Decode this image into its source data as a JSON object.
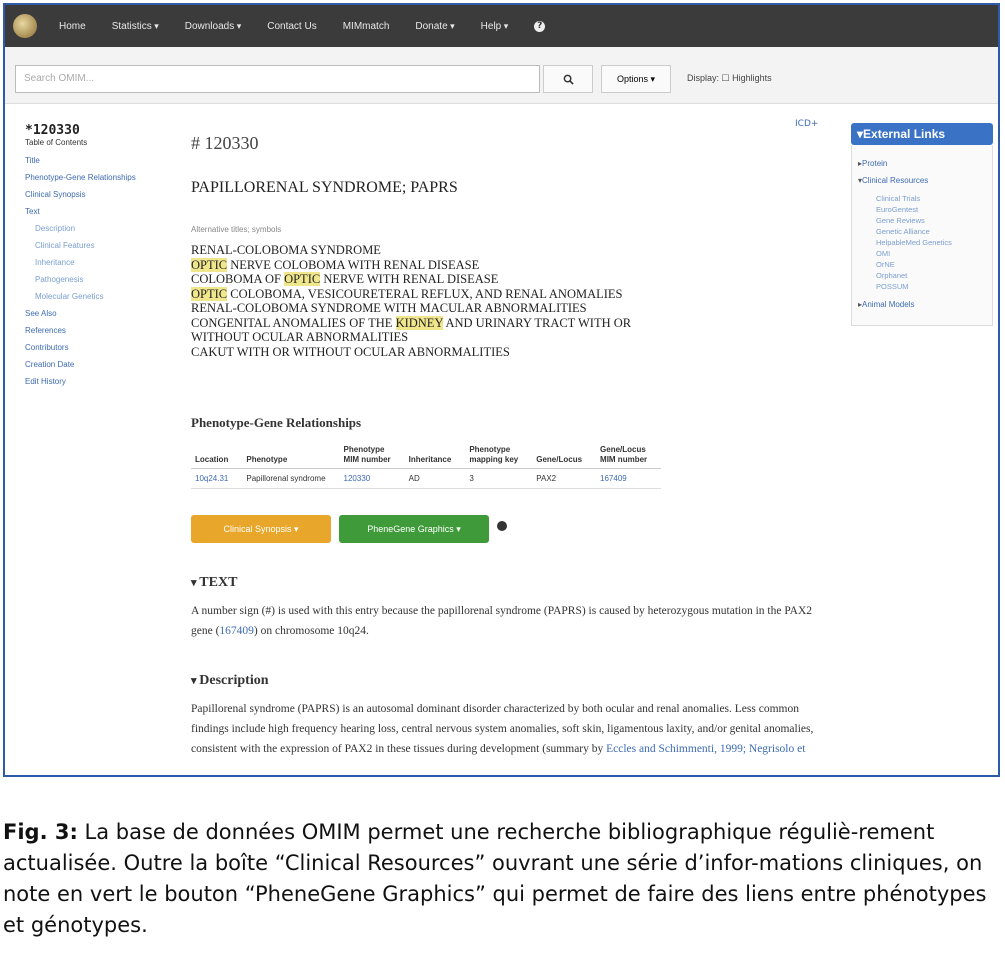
{
  "nav": {
    "items": [
      "Home",
      "Statistics",
      "Downloads",
      "Contact Us",
      "MIMmatch",
      "Donate",
      "Help"
    ],
    "help_icon": "?"
  },
  "search": {
    "placeholder": "Search OMIM...",
    "search_icon": "magnifier-icon",
    "options_label": "Options",
    "display_highlights": "Display: ☐ Highlights"
  },
  "toc": {
    "entry_number": "*120330",
    "heading": "Table of Contents",
    "items": [
      {
        "label": "Title",
        "sub": false
      },
      {
        "label": "Phenotype-Gene Relationships",
        "sub": false
      },
      {
        "label": "Clinical Synopsis",
        "sub": false
      },
      {
        "label": "Text",
        "sub": false
      },
      {
        "label": "Description",
        "sub": true
      },
      {
        "label": "Clinical Features",
        "sub": true
      },
      {
        "label": "Inheritance",
        "sub": true
      },
      {
        "label": "Pathogenesis",
        "sub": true
      },
      {
        "label": "Molecular Genetics",
        "sub": true
      },
      {
        "label": "See Also",
        "sub": false
      },
      {
        "label": "References",
        "sub": false
      },
      {
        "label": "Contributors",
        "sub": false
      },
      {
        "label": "Creation Date",
        "sub": false
      },
      {
        "label": "Edit History",
        "sub": false
      }
    ]
  },
  "entry": {
    "number": "# 120330",
    "title": "PAPILLORENAL SYNDROME; PAPRS",
    "alt_titles_label": "Alternative titles; symbols",
    "alt_titles": [
      {
        "parts": [
          {
            "t": "RENAL-COLOBOMA SYNDROME",
            "hl": false
          }
        ]
      },
      {
        "parts": [
          {
            "t": "OPTIC",
            "hl": true
          },
          {
            "t": " NERVE COLOBOMA WITH RENAL DISEASE",
            "hl": false
          }
        ]
      },
      {
        "parts": [
          {
            "t": "COLOBOMA OF ",
            "hl": false
          },
          {
            "t": "OPTIC",
            "hl": true
          },
          {
            "t": " NERVE WITH RENAL DISEASE",
            "hl": false
          }
        ]
      },
      {
        "parts": [
          {
            "t": "OPTIC",
            "hl": true
          },
          {
            "t": " COLOBOMA, VESICOURETERAL REFLUX, AND RENAL ANOMALIES",
            "hl": false
          }
        ]
      },
      {
        "parts": [
          {
            "t": "RENAL-COLOBOMA SYNDROME WITH MACULAR ABNORMALITIES",
            "hl": false
          }
        ]
      },
      {
        "parts": [
          {
            "t": "CONGENITAL ANOMALIES OF THE ",
            "hl": false
          },
          {
            "t": "KIDNEY",
            "hl": true
          },
          {
            "t": " AND URINARY TRACT WITH OR",
            "hl": false
          }
        ]
      },
      {
        "parts": [
          {
            "t": "WITHOUT OCULAR ABNORMALITIES",
            "hl": false
          }
        ]
      },
      {
        "parts": [
          {
            "t": "CAKUT WITH OR WITHOUT OCULAR ABNORMALITIES",
            "hl": false
          }
        ]
      }
    ]
  },
  "pg": {
    "title": "Phenotype-Gene Relationships",
    "headers": [
      "Location",
      "Phenotype",
      "Phenotype\nMIM number",
      "Inheritance",
      "Phenotype\nmapping key",
      "Gene/Locus",
      "Gene/Locus\nMIM number"
    ],
    "rows": [
      [
        "10q24.31",
        "Papillorenal syndrome",
        "120330",
        "AD",
        "3",
        "PAX2",
        "167409"
      ]
    ]
  },
  "buttons": {
    "clinical_synopsis": "Clinical Synopsis",
    "phenegene": "PheneGene Graphics"
  },
  "text_section": {
    "heading": "TEXT",
    "para_pre": "A number sign (#) is used with this entry because the papillorenal syndrome (PAPRS) is caused by heterozygous mutation in the PAX2 gene (",
    "para_link": "167409",
    "para_post": ") on chromosome 10q24."
  },
  "description_section": {
    "heading": "Description",
    "para_pre": "Papillorenal syndrome (PAPRS) is an autosomal dominant disorder characterized by both ocular and renal anomalies. Less common findings include high frequency hearing loss, central nervous system anomalies, soft skin, ligamentous laxity, and/or genital anomalies, consistent with the expression of PAX2 in these tissues during development (summary by ",
    "para_link": "Eccles and Schimmenti, 1999; Negrisolo et",
    "para_post": ""
  },
  "external": {
    "heading": "External Links",
    "sections": [
      {
        "label": "Protein",
        "open": false,
        "links": []
      },
      {
        "label": "Clinical Resources",
        "open": true,
        "links": [
          "Clinical Trials",
          "EuroGentest",
          "Gene Reviews",
          "Genetic Alliance",
          "HelpableMed Genetics",
          "OMI",
          "OrNE",
          "Orphanet",
          "POSSUM"
        ]
      },
      {
        "label": "Animal Models",
        "open": false,
        "links": []
      }
    ],
    "icon_ctrl": "ICD+"
  },
  "caption": {
    "label": "Fig. 3:",
    "text": " La base de données OMIM permet une recherche bibliographique réguliè-rement actualisée. Outre la boîte “Clinical Resources” ouvrant une série d’infor-mations cliniques, on note en vert le bouton “PheneGene Graphics” qui permet de faire des liens entre phénotypes et génotypes."
  },
  "colors": {
    "nav_bg": "#3b3b3b",
    "link": "#3d6bb3",
    "highlight": "#f0e68c",
    "orange_button": "#e8a72a",
    "green_button": "#3f9a3a",
    "external_header": "#3a72c6",
    "frame_border": "#2f5aa8"
  }
}
